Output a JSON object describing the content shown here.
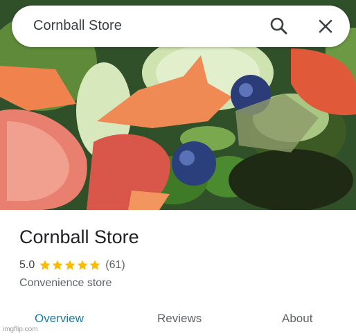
{
  "search": {
    "query": "Cornball Store",
    "search_icon": "search-icon",
    "close_icon": "close-icon"
  },
  "photo": {
    "subject": "store-photo"
  },
  "place": {
    "name": "Cornball Store",
    "rating": "5.0",
    "stars": 5,
    "review_count": "(61)",
    "category": "Convenience store"
  },
  "tabs": [
    {
      "label": "Overview",
      "active": true
    },
    {
      "label": "Reviews",
      "active": false
    },
    {
      "label": "About",
      "active": false
    }
  ],
  "colors": {
    "active_tab": "#1a7d9d",
    "star": "#fbbc04",
    "text_primary": "#202124",
    "text_secondary": "#5f6368"
  },
  "watermark": "imgflip.com"
}
